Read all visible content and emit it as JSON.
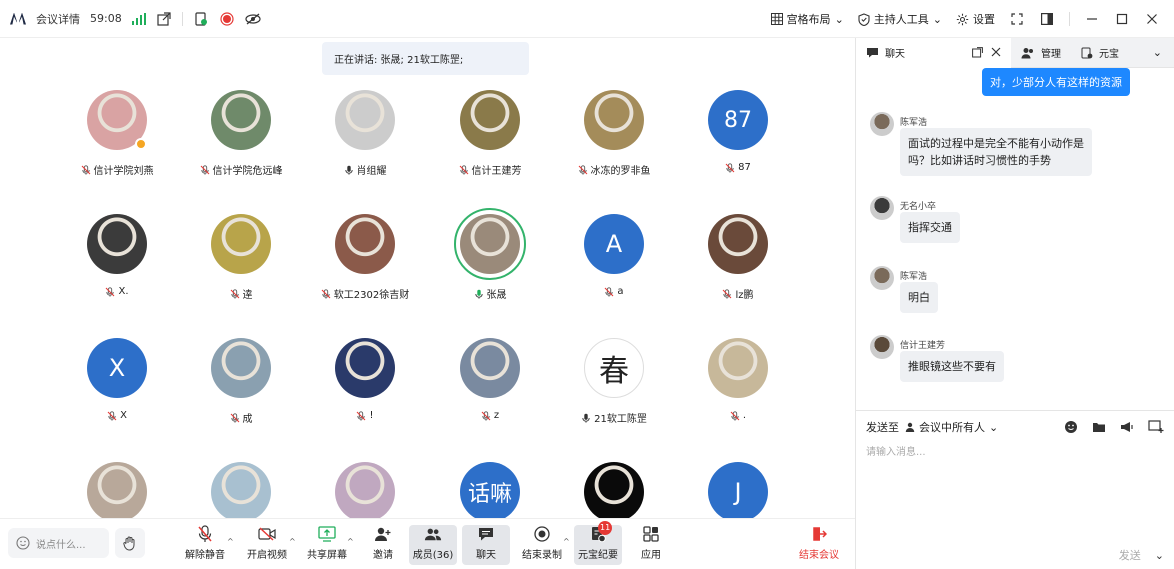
{
  "titlebar": {
    "meeting_info_label": "会议详情",
    "duration": "59:08",
    "layout_label": "宫格布局",
    "host_tools_label": "主持人工具",
    "settings_label": "设置"
  },
  "speaking_banner": "正在讲话: 张晟; 21软工陈罡;",
  "participants": [
    {
      "name": "信计学院刘燕",
      "mic": "off",
      "avatar": "photo",
      "host": true,
      "color": "#d9a3a3"
    },
    {
      "name": "信计学院危远峰",
      "mic": "off",
      "avatar": "photo",
      "color": "#6f8a6a"
    },
    {
      "name": "肖组耀",
      "mic": "on",
      "avatar": "photo",
      "color": "#cccccc"
    },
    {
      "name": "信计王建芳",
      "mic": "off",
      "avatar": "photo",
      "color": "#8a7a4a"
    },
    {
      "name": "冰冻的罗非鱼",
      "mic": "off",
      "avatar": "photo",
      "color": "#a48c5a"
    },
    {
      "name": "87",
      "mic": "off",
      "avatar": "text",
      "text": "87"
    },
    {
      "name": "X.",
      "mic": "off",
      "avatar": "photo",
      "color": "#3b3b3b"
    },
    {
      "name": "逹",
      "mic": "off",
      "avatar": "photo",
      "color": "#b8a44a"
    },
    {
      "name": "软工2302徐吉财",
      "mic": "off",
      "avatar": "photo",
      "color": "#8b5a4a"
    },
    {
      "name": "张晟",
      "mic": "speaking",
      "avatar": "photo",
      "color": "#9a8a7a",
      "speaking": true
    },
    {
      "name": "a",
      "mic": "off",
      "avatar": "text",
      "text": "A"
    },
    {
      "name": "lz鹏",
      "mic": "off",
      "avatar": "photo",
      "color": "#6a4a3a"
    },
    {
      "name": "X",
      "mic": "off",
      "avatar": "text",
      "text": "X"
    },
    {
      "name": "成",
      "mic": "off",
      "avatar": "photo",
      "color": "#8aa0b0"
    },
    {
      "name": "!",
      "mic": "off",
      "avatar": "photo",
      "color": "#2a3a6a"
    },
    {
      "name": "z",
      "mic": "off",
      "avatar": "photo",
      "color": "#7a8aa0"
    },
    {
      "name": "21软工陈罡",
      "mic": "on",
      "avatar": "char",
      "text": "春"
    },
    {
      "name": ".",
      "mic": "off",
      "avatar": "photo",
      "color": "#c7b89a"
    },
    {
      "name": "",
      "mic": "off",
      "avatar": "photo",
      "color": "#b8a89a"
    },
    {
      "name": "",
      "mic": "off",
      "avatar": "photo",
      "color": "#a8c0d0"
    },
    {
      "name": "",
      "mic": "off",
      "avatar": "photo",
      "color": "#c0a8c0"
    },
    {
      "name": "",
      "mic": "off",
      "avatar": "text",
      "text": "话嘛"
    },
    {
      "name": "",
      "mic": "off",
      "avatar": "photo",
      "color": "#0a0a0a"
    },
    {
      "name": "",
      "mic": "off",
      "avatar": "text",
      "text": "J"
    }
  ],
  "toolbar": {
    "say_placeholder": "说点什么...",
    "unmute_label": "解除静音",
    "video_label": "开启视频",
    "share_label": "共享屏幕",
    "invite_label": "邀请",
    "members_label": "成员(36)",
    "chat_label": "聊天",
    "record_label": "结束录制",
    "minutes_label": "元宝纪要",
    "minutes_badge": "11",
    "apps_label": "应用",
    "end_label": "结束会议"
  },
  "panel": {
    "tab_chat": "聊天",
    "tab_manage": "管理",
    "tab_yuanbao": "元宝",
    "my_message": "对，少部分人有这样的资源",
    "messages": [
      {
        "sender": "陈军浩",
        "text_line1": "面试的过程中是完全不能有小动作是",
        "text_line2": "吗？比如讲话时习惯性的手势",
        "color": "#7a6a5a"
      },
      {
        "sender": "无名小卒",
        "text_line1": "指挥交通",
        "color": "#3a3a3a"
      },
      {
        "sender": "陈军浩",
        "text_line1": "明白",
        "color": "#7a6a5a"
      },
      {
        "sender": "信计王建芳",
        "text_line1": "推眼镜这些不要有",
        "color": "#5a4a3a"
      }
    ],
    "send_to_label": "发送至",
    "recipient": "会议中所有人",
    "input_placeholder": "请输入消息...",
    "send_label": "发送"
  },
  "colors": {
    "accent": "#1e88ff",
    "avatar_blue": "#2d6fc9",
    "danger": "#e53935",
    "signal": "#1fae5a"
  }
}
